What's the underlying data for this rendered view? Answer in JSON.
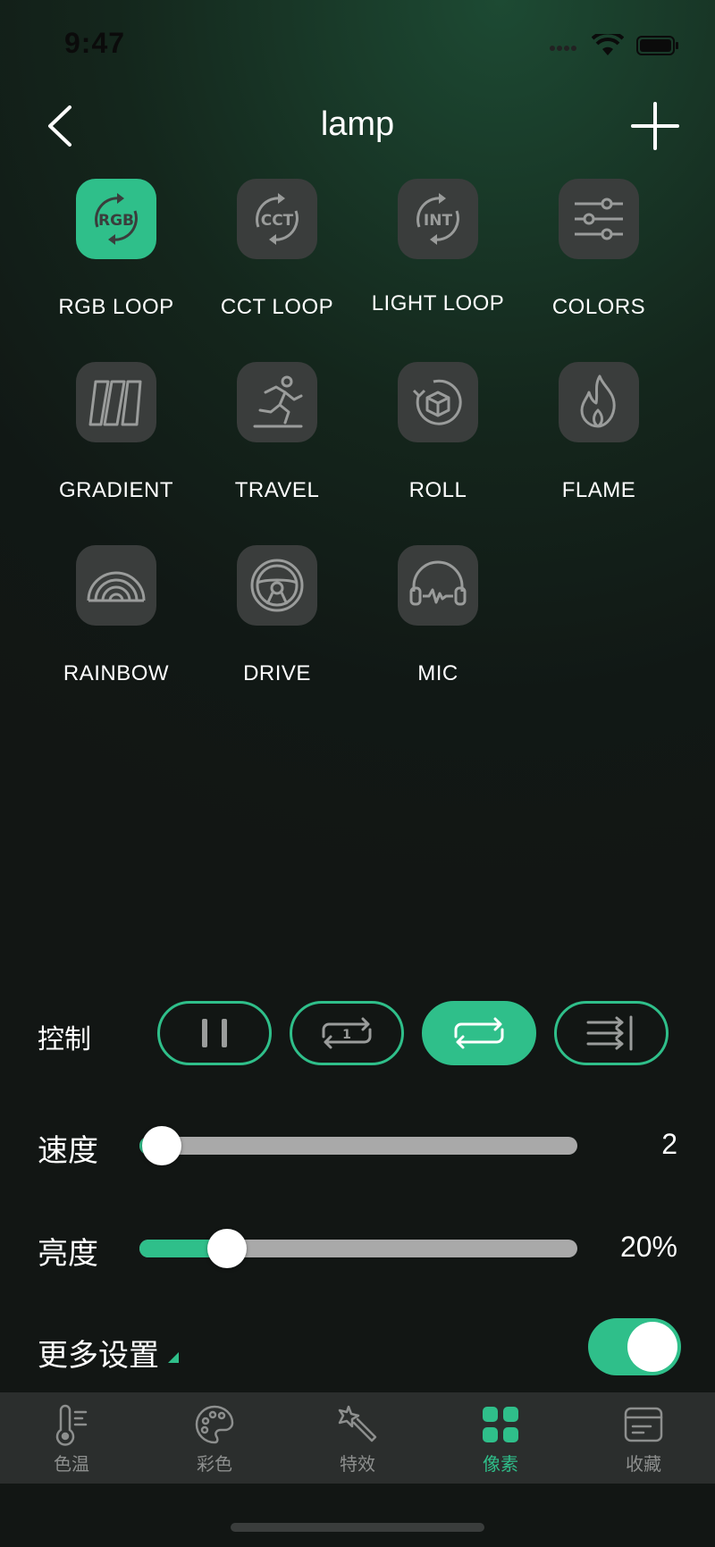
{
  "status_bar": {
    "time": "9:47"
  },
  "nav": {
    "title": "lamp"
  },
  "effects": [
    {
      "label": "RGB LOOP",
      "icon": "rgb-loop-icon",
      "active": true
    },
    {
      "label": "CCT LOOP",
      "icon": "cct-loop-icon",
      "active": false
    },
    {
      "label": "LIGHT LOOP",
      "icon": "int-loop-icon",
      "active": false
    },
    {
      "label": "COLORS",
      "icon": "sliders-icon",
      "active": false
    },
    {
      "label": "GRADIENT",
      "icon": "gradient-icon",
      "active": false
    },
    {
      "label": "TRAVEL",
      "icon": "running-person-icon",
      "active": false
    },
    {
      "label": "ROLL",
      "icon": "roll-icon",
      "active": false
    },
    {
      "label": "FLAME",
      "icon": "flame-icon",
      "active": false
    },
    {
      "label": "RAINBOW",
      "icon": "rainbow-icon",
      "active": false
    },
    {
      "label": "DRIVE",
      "icon": "steering-wheel-icon",
      "active": false
    },
    {
      "label": "MIC",
      "icon": "headphones-icon",
      "active": false
    }
  ],
  "control": {
    "label": "控制",
    "buttons": [
      {
        "icon": "pause-icon",
        "active": false
      },
      {
        "icon": "repeat-one-icon",
        "active": false,
        "text": "1"
      },
      {
        "icon": "repeat-icon",
        "active": true
      },
      {
        "icon": "sequence-icon",
        "active": false
      }
    ]
  },
  "speed": {
    "label": "速度",
    "value": "2",
    "fraction": 0.05
  },
  "brightness": {
    "label": "亮度",
    "value": "20%",
    "fraction": 0.2
  },
  "more_settings": {
    "label": "更多设置",
    "enabled": true
  },
  "tabs": [
    {
      "label": "色温",
      "icon": "thermometer-icon",
      "active": false
    },
    {
      "label": "彩色",
      "icon": "palette-icon",
      "active": false
    },
    {
      "label": "特效",
      "icon": "magic-wand-icon",
      "active": false
    },
    {
      "label": "像素",
      "icon": "pixel-grid-icon",
      "active": true
    },
    {
      "label": "收藏",
      "icon": "favorites-card-icon",
      "active": false
    }
  ],
  "colors": {
    "accent": "#2fbf8a",
    "tile": "#3a3d3c",
    "track": "#a9a9a9",
    "tabbar": "#2b2e2d"
  }
}
